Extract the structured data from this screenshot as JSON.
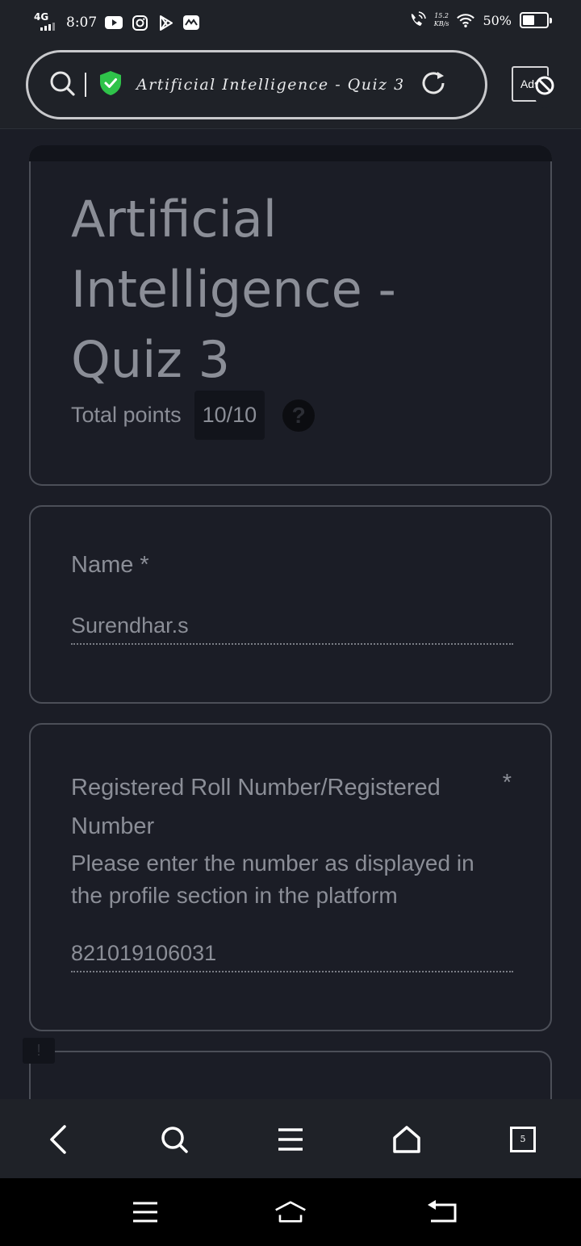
{
  "status_bar": {
    "network_type": "4G",
    "time": "8:07",
    "speed_value": "15.2",
    "speed_unit": "KB/s",
    "battery_percent": "50%",
    "battery_level": 0.5
  },
  "browser": {
    "page_title": "Artificial Intelligence - Quiz 3",
    "ads_label": "Ads",
    "tab_count": "5"
  },
  "form": {
    "title": "Artificial Intelligence - Quiz 3",
    "total_points_label": "Total points",
    "total_points_value": "10/10",
    "help_symbol": "?",
    "questions": [
      {
        "label": "Name *",
        "answer": "Surendhar.s"
      },
      {
        "label": "Registered Roll Number/Registered Number",
        "required_mark": "*",
        "help_text": "Please enter the number as displayed in the profile section in the platform",
        "answer": "821019106031"
      }
    ],
    "report_symbol": "!"
  },
  "icons": {
    "status_left": [
      "youtube-icon",
      "instagram-icon",
      "play-store-icon",
      "mail-icon"
    ],
    "status_right": [
      "wifi-calling-icon",
      "wifi-icon",
      "battery-icon"
    ],
    "browser_toolbar": [
      "back-icon",
      "search-icon",
      "menu-icon",
      "home-icon",
      "tabs-icon"
    ],
    "system_nav": [
      "recents-icon",
      "home-icon",
      "back-icon"
    ]
  }
}
